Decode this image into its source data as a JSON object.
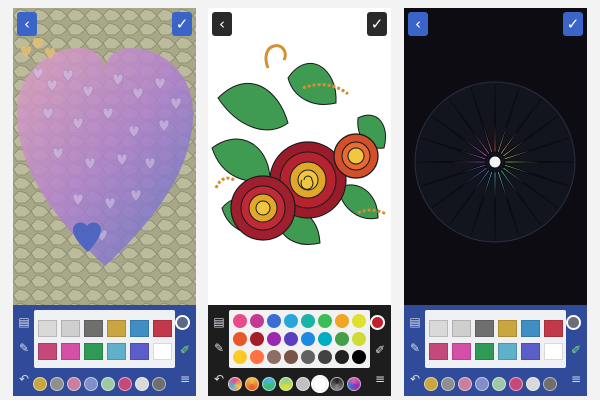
{
  "colors": {
    "toolbar_blue": "#2f4b9a",
    "toolbar_dark": "#1d1d1d",
    "button_blue": "#3b64c8",
    "button_dark": "#2a2a2a"
  },
  "icons": {
    "back": "‹",
    "done": "✓",
    "trash": "🗑",
    "brush": "✎",
    "eyedropper": "✐",
    "undo": "↶",
    "menu": "≡"
  },
  "screens": [
    {
      "theme": "glitter",
      "current_color": "#5b6a8a",
      "swatches": [
        "#d9d9d9",
        "#cfcfcf",
        "#6f6f6f",
        "#c9a640",
        "#3f8fc4",
        "#c23a4a",
        "#c4497a",
        "#d44fa6",
        "#2f9a56",
        "#5fb0c8",
        "#5b5ec8",
        "#ffffff"
      ],
      "strip": [
        "#c9a640",
        "#8f8f8f",
        "#c97f9e",
        "#7f8fc9",
        "#9ec9a6",
        "#c4497a",
        "#d9d9d9",
        "#6f6f6f"
      ]
    },
    {
      "theme": "solid",
      "current_color": "#c0222c",
      "swatches": [
        "#e94b8a",
        "#c23a94",
        "#3b6ed4",
        "#27a7d8",
        "#19b3a8",
        "#3bbd57",
        "#f0a524",
        "#e0e030",
        "#e8562c",
        "#a21f2a",
        "#9c27b0",
        "#5a3ec2",
        "#1e88e5",
        "#00acc1",
        "#43a047",
        "#cddc39",
        "#ffca28",
        "#ff7043",
        "#8d6e63",
        "#795548",
        "#616161",
        "#424242",
        "#212121",
        "#000000"
      ],
      "strip": [
        "#e94b8a",
        "#f0c040",
        "#4fb0e0",
        "#8fd08f",
        "#c0c0c0",
        "#ffffff",
        "#e060a0",
        "#222222"
      ]
    },
    {
      "theme": "glitter",
      "current_color": "#6b6e7a",
      "swatches": [
        "#d9d9d9",
        "#cfcfcf",
        "#6f6f6f",
        "#c9a640",
        "#3f8fc4",
        "#c23a4a",
        "#c4497a",
        "#d44fa6",
        "#2f9a56",
        "#5fb0c8",
        "#5b5ec8",
        "#ffffff"
      ],
      "strip": [
        "#c9a640",
        "#8f8f8f",
        "#c97f9e",
        "#7f8fc9",
        "#9ec9a6",
        "#c4497a",
        "#d9d9d9",
        "#6f6f6f"
      ]
    }
  ]
}
